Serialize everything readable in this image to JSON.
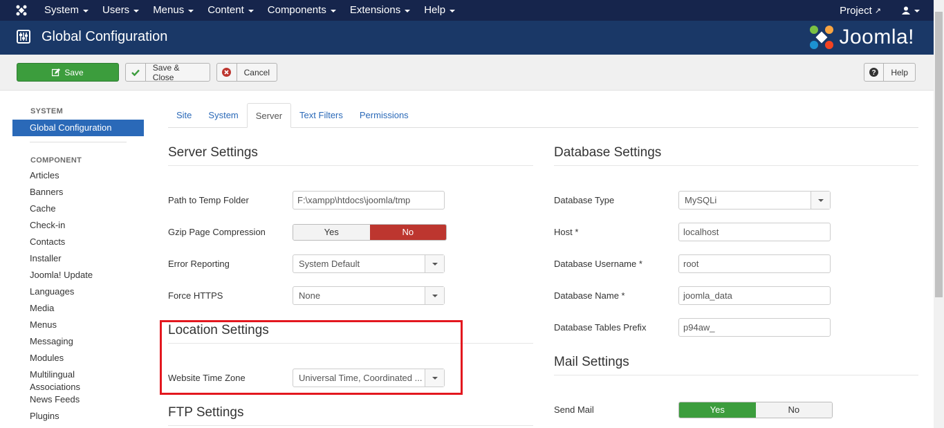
{
  "nav": {
    "menu": [
      "System",
      "Users",
      "Menus",
      "Content",
      "Components",
      "Extensions",
      "Help"
    ],
    "project": "Project"
  },
  "header": {
    "title": "Global Configuration",
    "brand": "Joomla!"
  },
  "toolbar": {
    "save": "Save",
    "save_close": "Save & Close",
    "cancel": "Cancel",
    "help": "Help"
  },
  "sidebar": {
    "system_heading": "SYSTEM",
    "active_item": "Global Configuration",
    "component_heading": "COMPONENT",
    "items": [
      "Articles",
      "Banners",
      "Cache",
      "Check-in",
      "Contacts",
      "Installer",
      "Joomla! Update",
      "Languages",
      "Media",
      "Menus",
      "Messaging",
      "Modules"
    ],
    "multilingual": "Multilingual Associations",
    "items_after": [
      "News Feeds",
      "Plugins"
    ]
  },
  "tabs": [
    "Site",
    "System",
    "Server",
    "Text Filters",
    "Permissions"
  ],
  "server_settings": {
    "title": "Server Settings",
    "temp_label": "Path to Temp Folder",
    "temp_value": "F:\\xampp\\htdocs\\joomla/tmp",
    "gzip_label": "Gzip Page Compression",
    "gzip_yes": "Yes",
    "gzip_no": "No",
    "error_label": "Error Reporting",
    "error_value": "System Default",
    "https_label": "Force HTTPS",
    "https_value": "None"
  },
  "location_settings": {
    "title": "Location Settings",
    "tz_label": "Website Time Zone",
    "tz_value": "Universal Time, Coordinated ..."
  },
  "ftp_settings": {
    "title": "FTP Settings"
  },
  "database_settings": {
    "title": "Database Settings",
    "type_label": "Database Type",
    "type_value": "MySQLi",
    "host_label": "Host *",
    "host_value": "localhost",
    "user_label": "Database Username *",
    "user_value": "root",
    "name_label": "Database Name *",
    "name_value": "joomla_data",
    "prefix_label": "Database Tables Prefix",
    "prefix_value": "p94aw_"
  },
  "mail_settings": {
    "title": "Mail Settings",
    "send_label": "Send Mail",
    "send_yes": "Yes",
    "send_no": "No"
  },
  "colors": {
    "nav_bg": "#16254c",
    "header_bg": "#1a3867",
    "save_green": "#3c9d3d",
    "no_red": "#bd362f",
    "link_blue": "#2a69b8",
    "highlight": "#e3171e"
  }
}
